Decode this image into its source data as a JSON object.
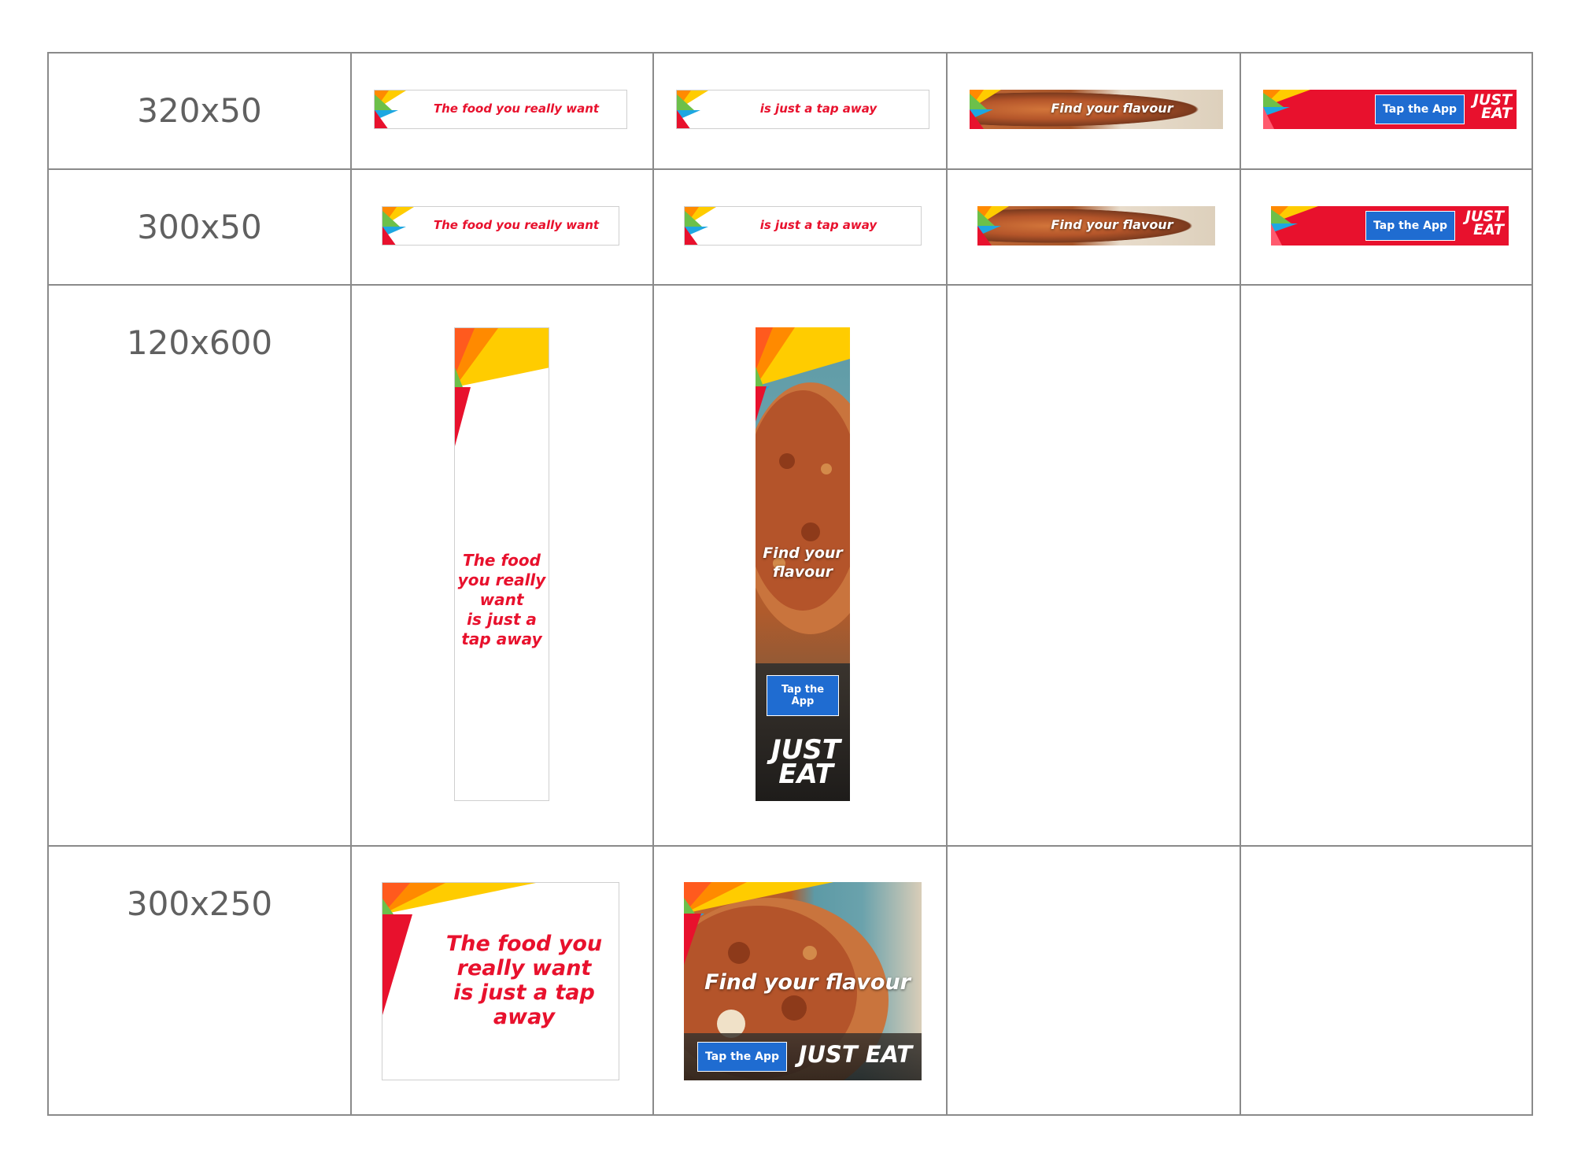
{
  "rows": [
    {
      "label": "320x50"
    },
    {
      "label": "300x50"
    },
    {
      "label": "120x600"
    },
    {
      "label": "300x250"
    }
  ],
  "creatives": {
    "copy_a": "The food you really want",
    "copy_b": "is just a tap away",
    "copy_c": "Find your flavour",
    "cta": "Tap the App",
    "logo_top": "JUST",
    "logo_bottom": "EAT",
    "logo_full": "JUST EAT",
    "tall_copy_lines": [
      "The food",
      "you really",
      "want",
      "is just a",
      "tap away"
    ],
    "tall_flavour_lines": [
      "Find your",
      "flavour"
    ],
    "tall_cta_lines": [
      "Tap the",
      "App"
    ],
    "mpu_copy_lines": [
      "The food you",
      "really want",
      "is just a tap",
      "away"
    ]
  },
  "colors": {
    "brand_red": "#e8112d",
    "cta_blue": "#1f6cd1",
    "label_gray": "#606060",
    "grid_gray": "#8a8a8a"
  }
}
